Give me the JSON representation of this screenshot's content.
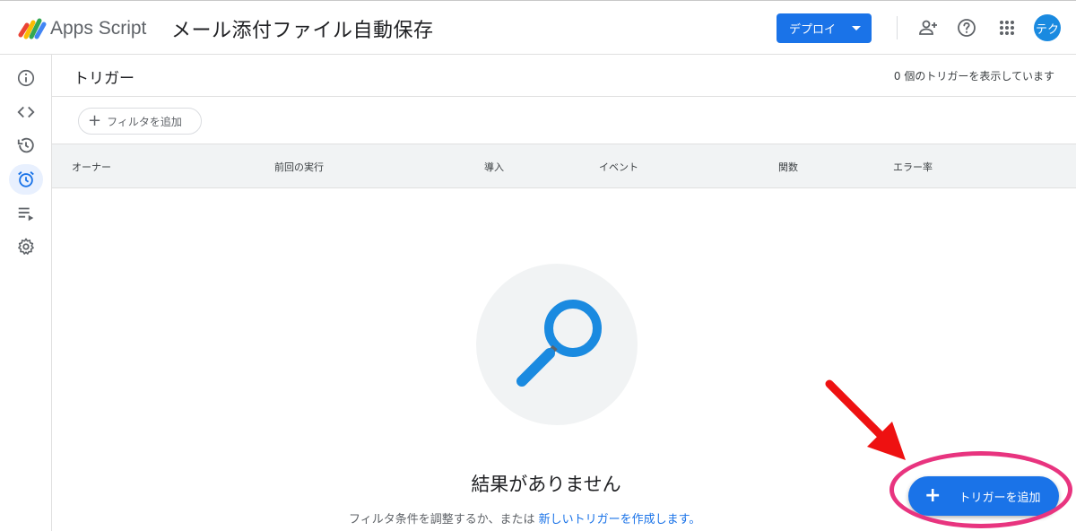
{
  "header": {
    "brand": "Apps Script",
    "project_title": "メール添付ファイル自動保存",
    "deploy_label": "デプロイ",
    "avatar_text": "テク"
  },
  "rail": {
    "items": [
      "overview-icon",
      "editor-icon",
      "executions-icon",
      "triggers-icon",
      "run-list-icon",
      "settings-icon"
    ],
    "active": "triggers-icon"
  },
  "main": {
    "title": "トリガー",
    "count_text": "0 個のトリガーを表示しています",
    "filter_label": "フィルタを追加",
    "columns": [
      "オーナー",
      "前回の実行",
      "導入",
      "イベント",
      "関数",
      "エラー率"
    ],
    "empty_title": "結果がありません",
    "empty_sub_prefix": "フィルタ条件を調整するか、または",
    "empty_sub_link": "新しいトリガーを作成します。"
  },
  "fab": {
    "label": "トリガーを追加"
  },
  "colors": {
    "accent": "#1a73e8",
    "annotation_ellipse": "#e8347f",
    "annotation_arrow": "#ee1111"
  }
}
